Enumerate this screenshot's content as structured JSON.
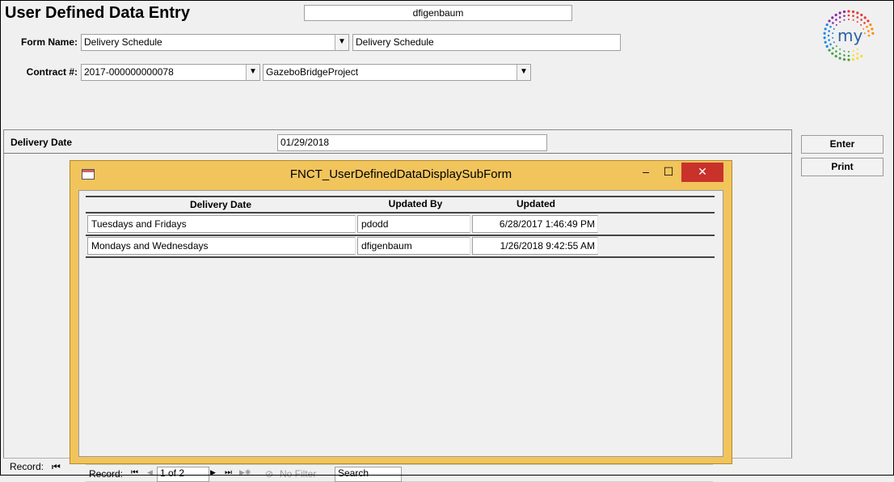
{
  "header": {
    "title": "User Defined Data Entry",
    "current_user": "dfigenbaum"
  },
  "form_name": {
    "label": "Form Name:",
    "value": "Delivery Schedule",
    "description": "Delivery Schedule"
  },
  "contract": {
    "label": "Contract #:",
    "value": "2017-000000000078",
    "project": "GazeboBridgeProject"
  },
  "logo": {
    "text": "my",
    "colors": [
      "#e53935",
      "#fb8c00",
      "#fdd835",
      "#43a047",
      "#1e88e5",
      "#8e24aa"
    ]
  },
  "detail": {
    "field_label": "Delivery Date",
    "field_value": "01/29/2018"
  },
  "buttons": {
    "enter": "Enter",
    "print": "Print"
  },
  "outer_nav": {
    "record_label": "Record:",
    "first_icon": "⏮"
  },
  "subform": {
    "caption": "FNCT_UserDefinedDataDisplaySubForm",
    "controls": {
      "minimize": "–",
      "maximize": "☐",
      "close": "✕"
    },
    "columns": [
      "Delivery Date",
      "Updated By",
      "Updated"
    ],
    "rows": [
      {
        "delivery_date": "Tuesdays and Fridays",
        "updated_by": "pdodd",
        "updated": "6/28/2017 1:46:49 PM"
      },
      {
        "delivery_date": "Mondays and Wednesdays",
        "updated_by": "dfigenbaum",
        "updated": "1/26/2018 9:42:55 AM"
      }
    ],
    "nav": {
      "record_label": "Record:",
      "first": "⏮",
      "prev": "◀",
      "position": "1 of 2",
      "next": "▶",
      "last": "⏭",
      "new": "▶✱",
      "filter_icon": "⊘",
      "filter_label": "No Filter",
      "search_label": "Search"
    }
  },
  "colors": {
    "window_border": "#f1c45c",
    "close_button": "#c9312b"
  }
}
